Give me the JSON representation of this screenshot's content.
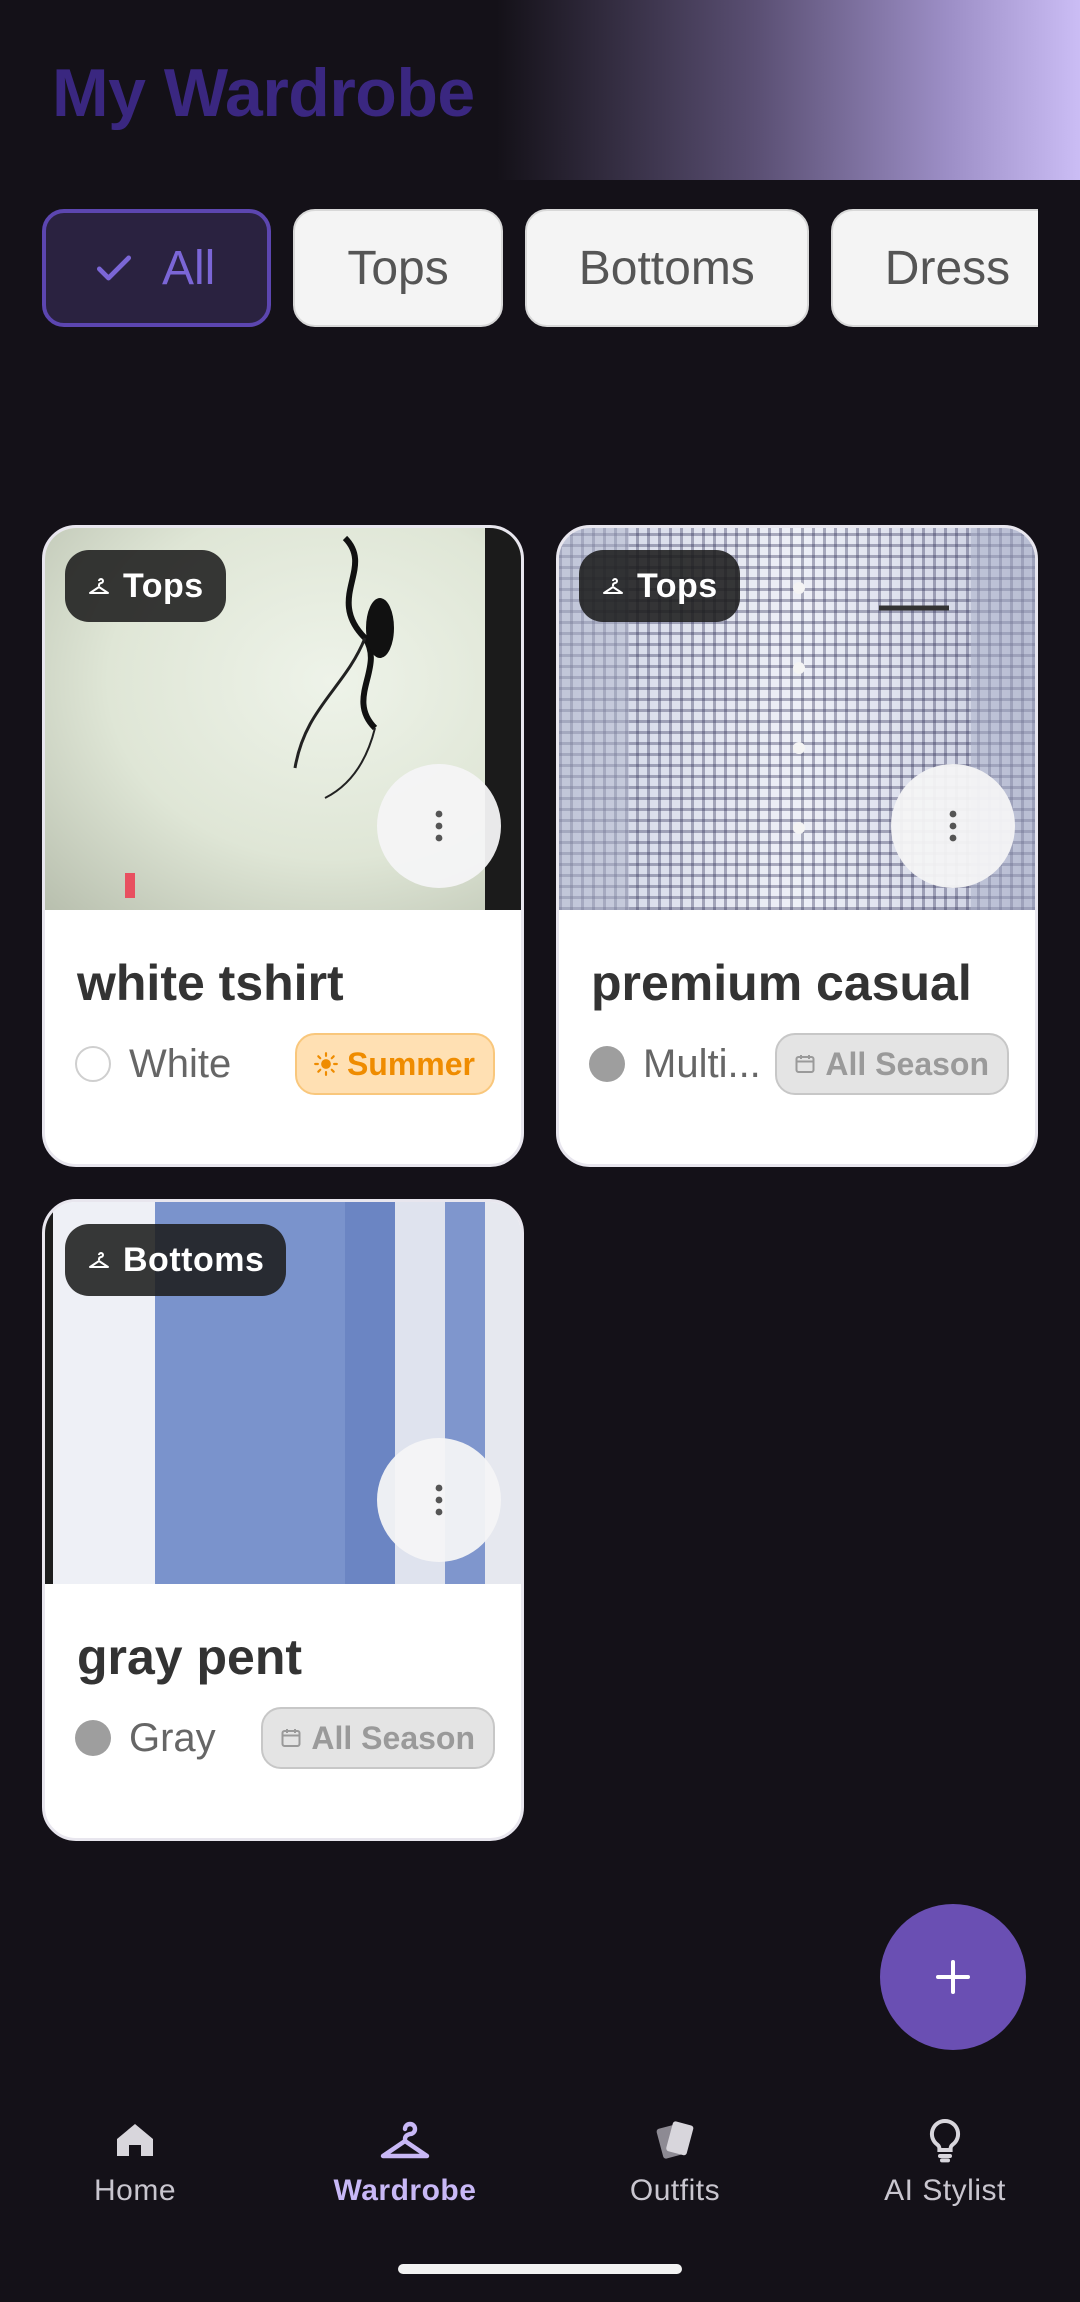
{
  "header": {
    "title": "My Wardrobe"
  },
  "filters": [
    {
      "label": "All",
      "selected": true
    },
    {
      "label": "Tops",
      "selected": false
    },
    {
      "label": "Bottoms",
      "selected": false
    },
    {
      "label": "Dress",
      "selected": false
    }
  ],
  "items": [
    {
      "category": "Tops",
      "name": "white tshirt",
      "color": "White",
      "color_hex": "#ffffff",
      "season": "Summer",
      "season_icon": "sun-icon"
    },
    {
      "category": "Tops",
      "name": "premium casual",
      "color": "Multi...",
      "color_hex": "#9e9e9e",
      "season": "All Season",
      "season_icon": "calendar-icon"
    },
    {
      "category": "Bottoms",
      "name": "gray pent",
      "color": "Gray",
      "color_hex": "#9e9e9e",
      "season": "All Season",
      "season_icon": "calendar-icon"
    }
  ],
  "fab": {
    "icon": "plus-icon"
  },
  "nav": [
    {
      "label": "Home",
      "icon": "home-icon",
      "active": false
    },
    {
      "label": "Wardrobe",
      "icon": "hanger-icon",
      "active": true
    },
    {
      "label": "Outfits",
      "icon": "outfits-icon",
      "active": false
    },
    {
      "label": "AI Stylist",
      "icon": "lightbulb-icon",
      "active": false
    }
  ],
  "colors": {
    "accent": "#6a4fb3",
    "background": "#141118",
    "summer": "#ef8c00"
  }
}
